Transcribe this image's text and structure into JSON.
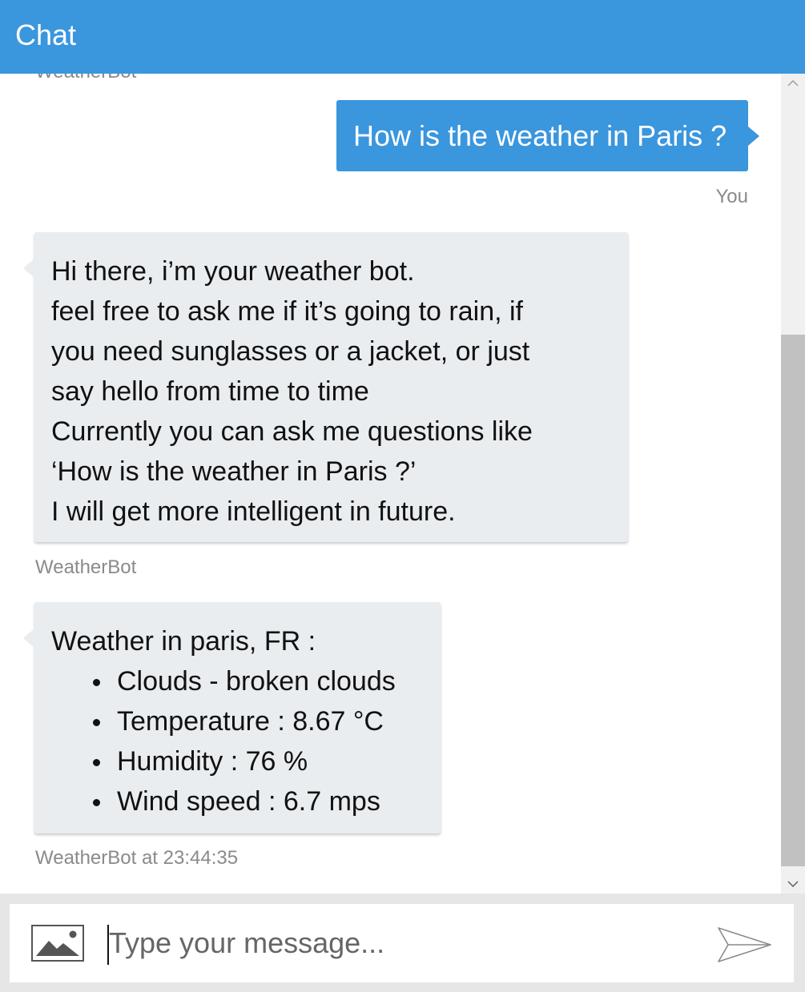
{
  "header": {
    "title": "Chat"
  },
  "history": {
    "cut_label": "WeatherBot",
    "messages": [
      {
        "from": "user",
        "text": "How is the weather in Paris ?",
        "label": "You"
      },
      {
        "from": "bot",
        "lines": [
          "Hi there, i’m your weather bot.",
          "feel free to ask me if it’s going to rain, if",
          "you need sunglasses or a jacket, or just",
          "say hello from time to time",
          "Currently you can ask me questions like",
          "‘How is the weather in Paris ?’",
          "I will get more intelligent in future."
        ],
        "label": "WeatherBot"
      },
      {
        "from": "bot",
        "heading": "Weather in paris, FR :",
        "bullets": [
          "Clouds - broken clouds",
          "Temperature : 8.67 °C",
          "Humidity : 76 %",
          "Wind speed : 6.7 mps"
        ],
        "label": "WeatherBot at 23:44:35"
      }
    ]
  },
  "input": {
    "value": "",
    "placeholder": "Type your message..."
  },
  "icons": {
    "upload": "image-icon",
    "send": "send-icon",
    "scroll_up": "chevron-up-icon",
    "scroll_down": "chevron-down-icon"
  },
  "colors": {
    "accent": "#3a96dd",
    "bot_bubble": "#eaedf0",
    "meta_text": "#8a8a8a"
  }
}
